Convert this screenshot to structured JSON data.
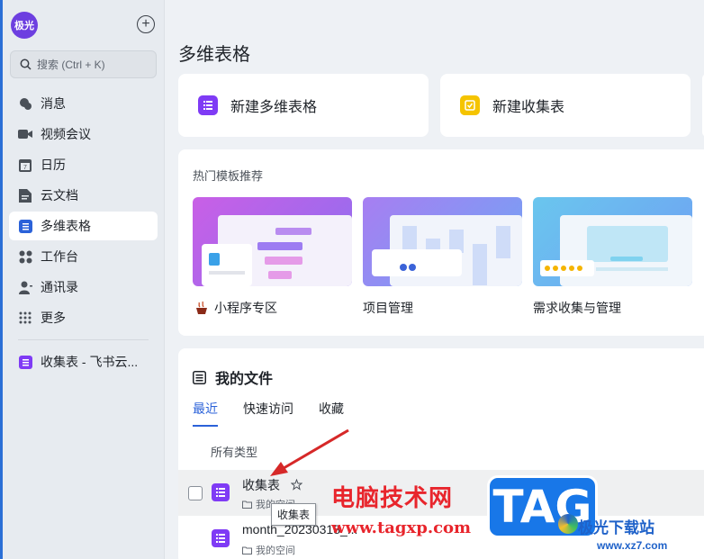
{
  "sidebar": {
    "avatar": "极光",
    "search_placeholder": "搜索 (Ctrl + K)",
    "items": [
      {
        "label": "消息",
        "icon": "message-icon"
      },
      {
        "label": "视频会议",
        "icon": "video-icon"
      },
      {
        "label": "日历",
        "icon": "calendar-icon"
      },
      {
        "label": "云文档",
        "icon": "cloud-doc-icon"
      },
      {
        "label": "多维表格",
        "icon": "base-icon"
      },
      {
        "label": "工作台",
        "icon": "workplace-icon"
      },
      {
        "label": "通讯录",
        "icon": "contacts-icon"
      },
      {
        "label": "更多",
        "icon": "more-icon"
      }
    ],
    "recent": {
      "label": "收集表 - 飞书云...",
      "icon": "form-doc-icon"
    }
  },
  "main": {
    "title": "多维表格",
    "new_base": "新建多维表格",
    "new_form": "新建收集表",
    "templates": {
      "title": "热门模板推荐",
      "items": [
        {
          "label": "小程序专区"
        },
        {
          "label": "项目管理"
        },
        {
          "label": "需求收集与管理"
        }
      ]
    },
    "files": {
      "title": "我的文件",
      "tabs": [
        "最近",
        "快速访问",
        "收藏"
      ],
      "filter": "所有类型",
      "rows": [
        {
          "name": "收集表",
          "location": "我的空间"
        },
        {
          "name": "month_20230318_...",
          "location": "我的空间"
        }
      ]
    },
    "tooltip": "收集表"
  },
  "watermark": {
    "line1": "电脑技术网",
    "line2": "www.tagxp.com",
    "tag": "TAG",
    "brand": "极光下载站",
    "url": "www.xz7.com"
  },
  "colors": {
    "accent": "#2b62d9",
    "base_icon": "#7f3bf5",
    "form_icon": "#f5c400",
    "avatar": "#6d3fe0"
  }
}
